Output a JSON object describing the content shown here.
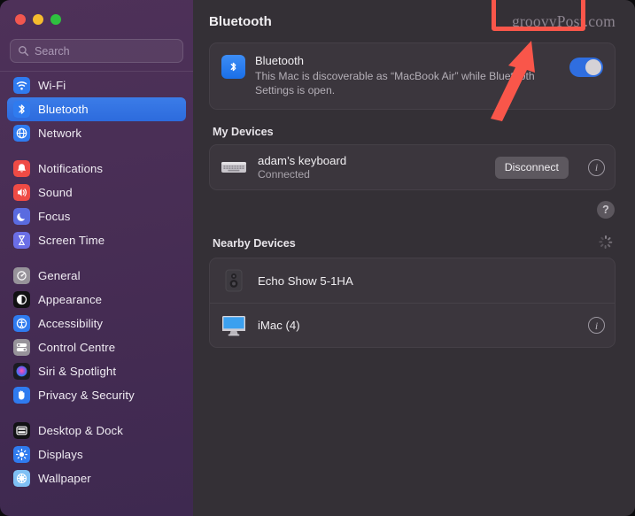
{
  "window": {
    "traffic_lights": [
      {
        "name": "close",
        "color": "#f2574f"
      },
      {
        "name": "minimize",
        "color": "#f5bc2e"
      },
      {
        "name": "zoom",
        "color": "#2ec13f"
      }
    ]
  },
  "sidebar": {
    "search": {
      "placeholder": "Search",
      "value": ""
    },
    "groups": [
      {
        "items": [
          {
            "label": "Wi-Fi",
            "icon": "wifi-icon",
            "selected": false
          },
          {
            "label": "Bluetooth",
            "icon": "bluetooth-icon",
            "selected": true
          },
          {
            "label": "Network",
            "icon": "globe-icon",
            "selected": false
          }
        ]
      },
      {
        "items": [
          {
            "label": "Notifications",
            "icon": "bell-icon",
            "selected": false
          },
          {
            "label": "Sound",
            "icon": "speaker-icon",
            "selected": false
          },
          {
            "label": "Focus",
            "icon": "moon-icon",
            "selected": false
          },
          {
            "label": "Screen Time",
            "icon": "hourglass-icon",
            "selected": false
          }
        ]
      },
      {
        "items": [
          {
            "label": "General",
            "icon": "gear-icon",
            "selected": false
          },
          {
            "label": "Appearance",
            "icon": "appearance-icon",
            "selected": false
          },
          {
            "label": "Accessibility",
            "icon": "accessibility-icon",
            "selected": false
          },
          {
            "label": "Control Centre",
            "icon": "control-centre-icon",
            "selected": false
          },
          {
            "label": "Siri & Spotlight",
            "icon": "siri-icon",
            "selected": false
          },
          {
            "label": "Privacy & Security",
            "icon": "hand-icon",
            "selected": false
          }
        ]
      },
      {
        "items": [
          {
            "label": "Desktop & Dock",
            "icon": "desktop-dock-icon",
            "selected": false
          },
          {
            "label": "Displays",
            "icon": "display-icon",
            "selected": false
          },
          {
            "label": "Wallpaper",
            "icon": "wallpaper-icon",
            "selected": false
          }
        ]
      }
    ]
  },
  "header": {
    "title": "Bluetooth",
    "watermark": "groovyPost.com"
  },
  "bluetooth_card": {
    "title": "Bluetooth",
    "description": "This Mac is discoverable as “MacBook Air” while Bluetooth Settings is open.",
    "toggle_on": true,
    "accent_color": "#2f6ee0"
  },
  "my_devices": {
    "heading": "My Devices",
    "devices": [
      {
        "name": "adam’s keyboard",
        "status": "Connected",
        "icon": "keyboard-icon",
        "action_label": "Disconnect",
        "has_info": true,
        "highlighted": true
      }
    ]
  },
  "help": {
    "label": "?"
  },
  "nearby_devices": {
    "heading": "Nearby Devices",
    "scanning": true,
    "devices": [
      {
        "name": "Echo Show 5-1HA",
        "icon": "speaker-device-icon",
        "has_info": false
      },
      {
        "name": "iMac (4)",
        "icon": "imac-icon",
        "has_info": true
      }
    ]
  },
  "annotations": {
    "highlight_color": "#f9564a",
    "box_target": "Disconnect",
    "arrow_points_to": "Disconnect"
  }
}
